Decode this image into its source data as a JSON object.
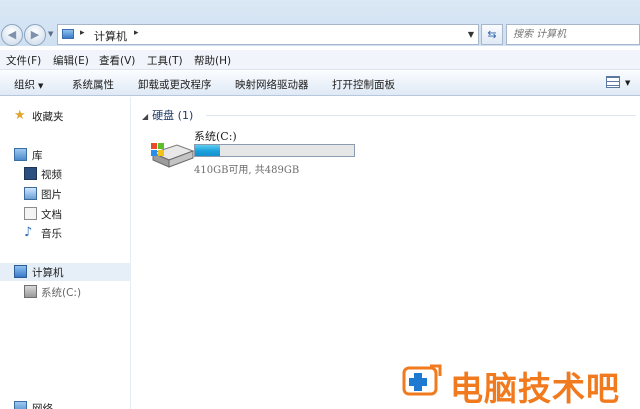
{
  "address_bar": {
    "crumb": "计算机",
    "search_placeholder": "搜索 计算机"
  },
  "menu": [
    "文件(F)",
    "编辑(E)",
    "查看(V)",
    "工具(T)",
    "帮助(H)"
  ],
  "commands": {
    "organize": "组织",
    "system_properties": "系统属性",
    "uninstall": "卸载或更改程序",
    "map_drive": "映射网络驱动器",
    "control_panel": "打开控制面板"
  },
  "sidebar": {
    "favorites": "收藏夹",
    "libraries": "库",
    "videos": "视频",
    "pictures": "图片",
    "documents": "文档",
    "music": "音乐",
    "computer": "计算机",
    "system_drive": "系统(C:)",
    "network": "网络"
  },
  "main": {
    "group_title": "硬盘 (1)",
    "drive": {
      "name": "系统(C:)",
      "free_text": "410GB可用, 共489GB",
      "used_fraction": 0.16
    }
  },
  "watermark": {
    "text": "电脑技术吧"
  },
  "colors": {
    "accent": "#1aa0dc",
    "watermark": "#f07a1d"
  }
}
